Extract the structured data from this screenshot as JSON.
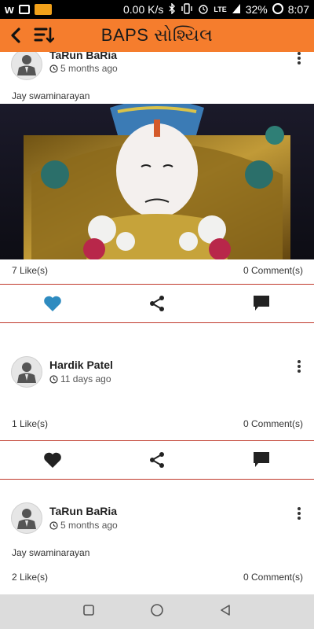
{
  "status_bar": {
    "speed": "0.00 K/s",
    "network": "LTE",
    "battery": "32%",
    "time": "8:07",
    "left_icons": [
      "w-icon",
      "image-icon",
      "app-notification-icon"
    ],
    "right_icons": [
      "bluetooth-icon",
      "vibrate-icon",
      "alarm-icon",
      "signal-icon",
      "battery-icon"
    ]
  },
  "app_bar": {
    "title": "BAPS સોશ્યિલ",
    "color": "#f57d2d",
    "icons": [
      "back-icon",
      "sort-icon"
    ]
  },
  "posts": [
    {
      "author": "TaRun BaRia",
      "time": "5 months ago",
      "text": "Jay swaminarayan",
      "has_image": true,
      "likes": "7 Like(s)",
      "comments": "0 Comment(s)",
      "liked": true
    },
    {
      "author": "Hardik Patel",
      "time": "11 days ago",
      "text": "",
      "has_image": false,
      "likes": "1 Like(s)",
      "comments": "0 Comment(s)",
      "liked": false
    },
    {
      "author": "TaRun BaRia",
      "time": "5 months ago",
      "text": "Jay swaminarayan",
      "has_image": false,
      "likes": "2 Like(s)",
      "comments": "0 Comment(s)",
      "liked": false
    }
  ],
  "actions": [
    "heart-icon",
    "share-icon",
    "comment-icon"
  ],
  "colors": {
    "accent": "#f57d2d",
    "liked_heart": "#2e8bc0",
    "divider": "#c0392b",
    "nav_bar": "#dcdcdc"
  },
  "nav_bar": {
    "icons": [
      "recents-square-icon",
      "home-circle-icon",
      "back-triangle-icon"
    ]
  }
}
